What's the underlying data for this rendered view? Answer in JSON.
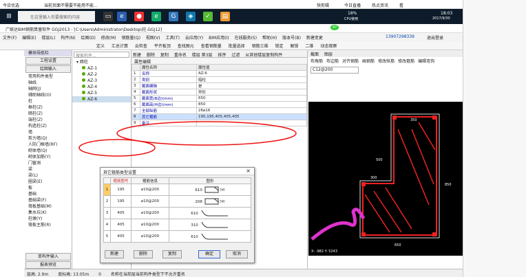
{
  "browser_bar": {
    "today": "今日优选",
    "headline": "当前页面不需要不能用不能...",
    "links": [
      "快剪辑",
      "今日直播",
      "热点资讯",
      "看"
    ]
  },
  "taskbar": {
    "search_placeholder": "在这里输入你要搜索的内容",
    "cpu": "18%",
    "cpu_label": "CPU使用",
    "time": "18:03",
    "date": "2017/9/30",
    "badge": "47"
  },
  "window": {
    "title": "广联达BIM钢筋算量软件 GGJ2013 - [C:\\Users\\Administrator\\Desktop\\柱.GGJ12]",
    "phone": "13907298339",
    "account": "退出登录"
  },
  "menu": [
    "文件(F)",
    "编辑(E)",
    "楼层(L)",
    "构件(N)",
    "绘图(D)",
    "修改(M)",
    "钢筋量(Q)",
    "视图(V)",
    "工具(T)",
    "云应用(Y)",
    "BIM应用(I)",
    "在线服务(S)",
    "帮助(H)",
    "版本号(B)",
    "新建变更"
  ],
  "toolbar": [
    "定义",
    "汇总计算",
    "云检查",
    "平齐板顶",
    "查找图元",
    "查看钢筋量",
    "批量选择",
    "钢筋三维",
    "锁定",
    "解锁",
    "二维",
    "动态观察"
  ],
  "nav": {
    "title": "模块导航栏",
    "buttons": [
      "工程设置",
      "绘图输入"
    ],
    "items": [
      "常用构件类型",
      "轴线",
      "轴网(J)",
      "辅助轴线(O)",
      "柱",
      "框柱(Z)",
      "暗柱(Z)",
      "端柱(Z)",
      "构造柱(Z)",
      "墙",
      "剪力墙(Q)",
      "人防门框墙(RF)",
      "砌体墙(Q)",
      "砌体加筋(Y)",
      "门窗洞",
      "梁",
      "梁(L)",
      "圈梁(E)",
      "板",
      "基础",
      "基础梁(F)",
      "筏板基础(M)",
      "集水坑(K)",
      "柱墩(Y)",
      "筏板主筋(R)"
    ],
    "bottom": [
      "单构件输入",
      "报表预览"
    ]
  },
  "tree": {
    "search": "搜索构件...",
    "root": "暗柱",
    "items": [
      "AZ-1",
      "AZ-2",
      "AZ-3",
      "AZ-4",
      "AZ-5",
      "AZ-6"
    ]
  },
  "propbar": [
    "新建",
    "删除",
    "复制",
    "重命名",
    "楼层 第3层",
    "排序",
    "过滤",
    "从其他楼层复制构件"
  ],
  "props": {
    "tab": "属性编辑",
    "headers": [
      "属性名称",
      "属性值"
    ],
    "rows": [
      [
        "1",
        "名称",
        "AZ-6"
      ],
      [
        "2",
        "类别",
        "暗柱"
      ],
      [
        "3",
        "截面编辑",
        "是"
      ],
      [
        "4",
        "截面形状",
        "异形"
      ],
      [
        "5",
        "截面宽(B边)(mm)",
        "650"
      ],
      [
        "6",
        "截面高(H边)(mm)",
        "850"
      ],
      [
        "7",
        "全部纵筋",
        "26⌀16"
      ],
      [
        "8",
        "其它箍筋",
        "195,195,405,405,405"
      ],
      [
        "9",
        "备注",
        ""
      ]
    ]
  },
  "dialog": {
    "title": "其它箍筋类型设置",
    "headers": [
      "箍筋图号",
      "箍筋信息",
      "图形"
    ],
    "rows": [
      {
        "no": "1",
        "code": "195",
        "info": "⌀10@200",
        "dim": "610",
        "dim2": "160"
      },
      {
        "no": "2",
        "code": "195",
        "info": "⌀10@200",
        "dim": "208",
        "dim2": "160"
      },
      {
        "no": "3",
        "code": "405",
        "info": "⌀10@200",
        "dim": "610",
        "dim2": ""
      },
      {
        "no": "4",
        "code": "405",
        "info": "⌀10@200",
        "dim": "310",
        "dim2": ""
      },
      {
        "no": "5",
        "code": "405",
        "info": "⌀10@200",
        "dim": "610",
        "dim2": ""
      }
    ],
    "buttons": [
      "新建",
      "删除",
      "复制",
      "确定",
      "取消"
    ]
  },
  "cad": {
    "tabs": [
      "截面",
      "图层"
    ],
    "tools": [
      "布角筋",
      "布边筋",
      "对齐钢筋",
      "画钢筋",
      "修改纵筋",
      "修改箍筋",
      "编辑弯钩"
    ],
    "combo": "C12@200",
    "dims": [
      "350",
      "500",
      "300",
      "850",
      "650"
    ],
    "coord": "X: -982 Y: 5243"
  },
  "status": {
    "floor": "层高: 2.9m",
    "base": "底标高: 13.05m",
    "zero": "0",
    "message": "名称在当前层当前构件类型下不允许重名"
  }
}
